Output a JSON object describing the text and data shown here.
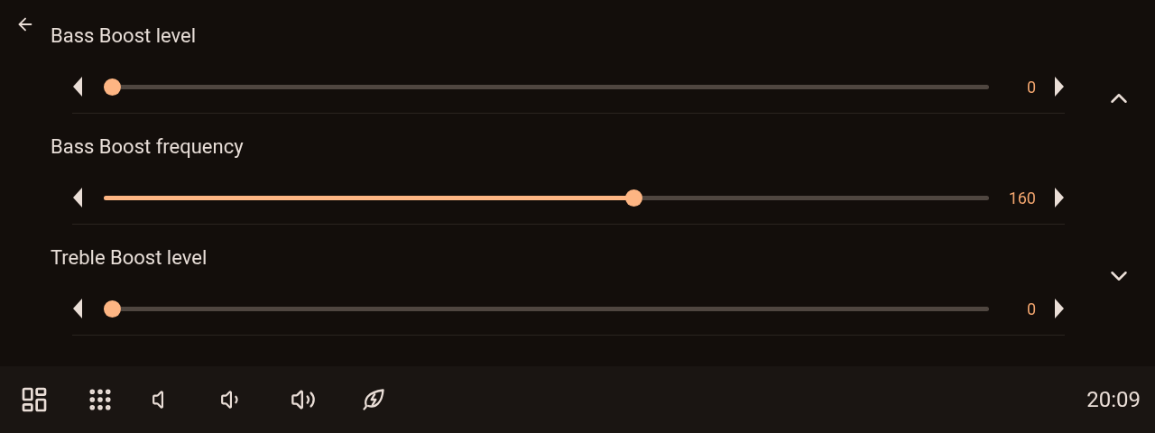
{
  "settings": [
    {
      "title": "Bass Boost level",
      "level": 0,
      "reading": "0"
    },
    {
      "title": "Bass Boost frequency",
      "level": 0.6,
      "reading": "160"
    },
    {
      "title": "Treble Boost level",
      "level": 0,
      "reading": "0"
    }
  ],
  "clock": "20:09"
}
